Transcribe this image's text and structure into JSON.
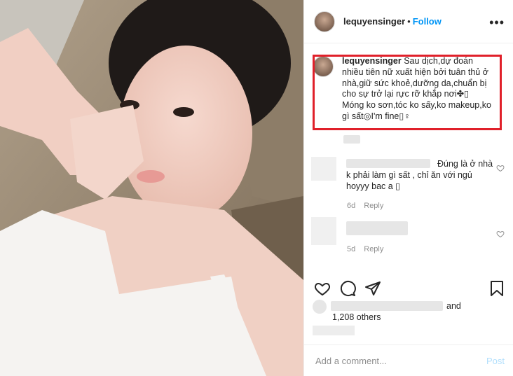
{
  "post": {
    "username": "lequyensinger",
    "separator": "•",
    "follow_label": "Follow",
    "more_label": "•••",
    "caption_username": "lequyensinger",
    "caption_text": " Sau dịch,dự đoán nhiều tiên nữ xuất hiện bởi tuân thủ ở nhà,giữ sức khoẻ,dưỡng da,chuẩn bị cho sự trở lại rực rỡ khắp nơi✤▯ Móng ko sơn,tóc ko sấy,ko makeup,ko gì sất◎I'm fine▯♀"
  },
  "comments": [
    {
      "text": "Đúng là ở nhà k phải làm gì sất , chỉ ăn với ngủ hoyyy bac a ▯",
      "age": "6d",
      "reply_label": "Reply"
    },
    {
      "text": "",
      "age": "5d",
      "reply_label": "Reply"
    }
  ],
  "likes": {
    "and_label": "and",
    "others_label": "1,208 others"
  },
  "comment_box": {
    "placeholder": "Add a comment...",
    "post_label": "Post"
  },
  "icons": {
    "like": "heart-icon",
    "comment": "comment-icon",
    "share": "share-icon",
    "save": "bookmark-icon"
  },
  "colors": {
    "follow": "#0095f6",
    "highlight_box": "#e0202a",
    "post_disabled": "#b2dffc"
  }
}
